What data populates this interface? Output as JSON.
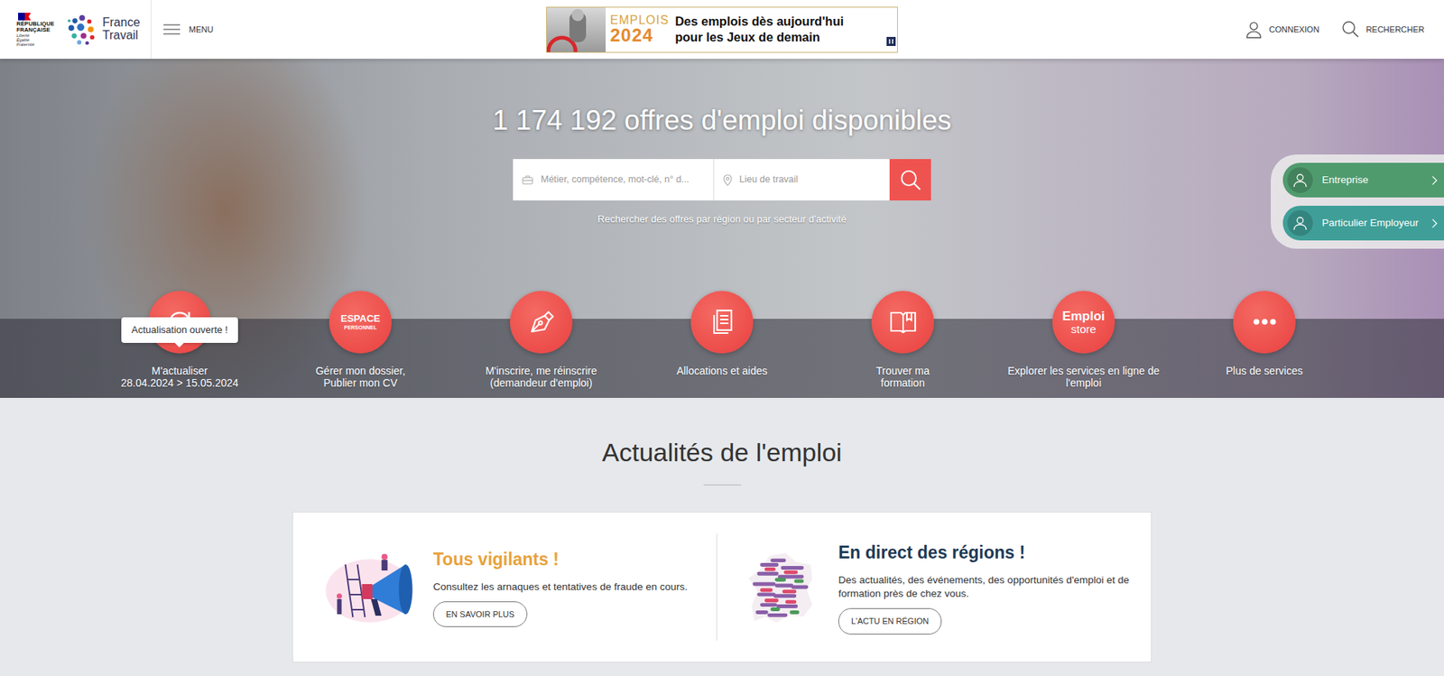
{
  "header": {
    "republic": [
      "RÉPUBLIQUE",
      "FRANÇAISE"
    ],
    "motto": [
      "Liberté",
      "Égalité",
      "Fraternité"
    ],
    "brand": [
      "France",
      "Travail"
    ],
    "menu": "MENU",
    "banner": {
      "word": "EMPLOIS",
      "year": "2024",
      "lines": [
        "Des emplois dès aujourd'hui",
        "pour les Jeux de demain"
      ]
    },
    "actions": [
      {
        "label": "CONNEXION",
        "kind": "user"
      },
      {
        "label": "RECHERCHER",
        "kind": "search"
      }
    ]
  },
  "hero": {
    "title": "1 174 192 offres d'emploi disponibles",
    "search": {
      "what_placeholder": "Métier, compétence, mot-clé, n° d...",
      "where_placeholder": "Lieu de travail"
    },
    "browse_link": "Rechercher des offres par région ou par secteur d'activité",
    "side_links": [
      {
        "label": "Entreprise",
        "color": "#4f9b6e"
      },
      {
        "label": "Particulier Employeur",
        "color": "#3f9f98"
      }
    ],
    "tooltip": "Actualisation ouverte !",
    "services": [
      {
        "kind": "refresh",
        "lines": [
          "M'actualiser",
          "28.04.2024 > 15.05.2024"
        ]
      },
      {
        "kind": "espace",
        "icon_text": [
          "ESPACE",
          "PERSONNEL"
        ],
        "lines": [
          "Gérer mon dossier,",
          "Publier mon CV"
        ]
      },
      {
        "kind": "pen",
        "lines": [
          "M'inscrire, me réinscrire",
          "(demandeur d'emploi)"
        ]
      },
      {
        "kind": "document",
        "lines": [
          "Allocations et aides"
        ]
      },
      {
        "kind": "book",
        "lines": [
          "Trouver ma",
          "formation"
        ]
      },
      {
        "kind": "store",
        "icon_text": [
          "Emploi",
          "store"
        ],
        "lines": [
          "Explorer les services en ligne de",
          "l'emploi"
        ]
      },
      {
        "kind": "dots",
        "lines": [
          "Plus de services"
        ]
      }
    ]
  },
  "news": {
    "title": "Actualités de l'emploi",
    "items": [
      {
        "kind": "alert",
        "title": "Tous vigilants !",
        "text": "Consultez les arnaques et tentatives de fraude en cours.",
        "button": "EN SAVOIR PLUS",
        "color": "#e8a23a"
      },
      {
        "kind": "regions",
        "title": "En direct des régions !",
        "text": "Des actualités, des événements, des opportunités d'emploi et de formation près de chez vous.",
        "button": "L'ACTU EN RÉGION",
        "color": "#1e3a55"
      }
    ]
  }
}
